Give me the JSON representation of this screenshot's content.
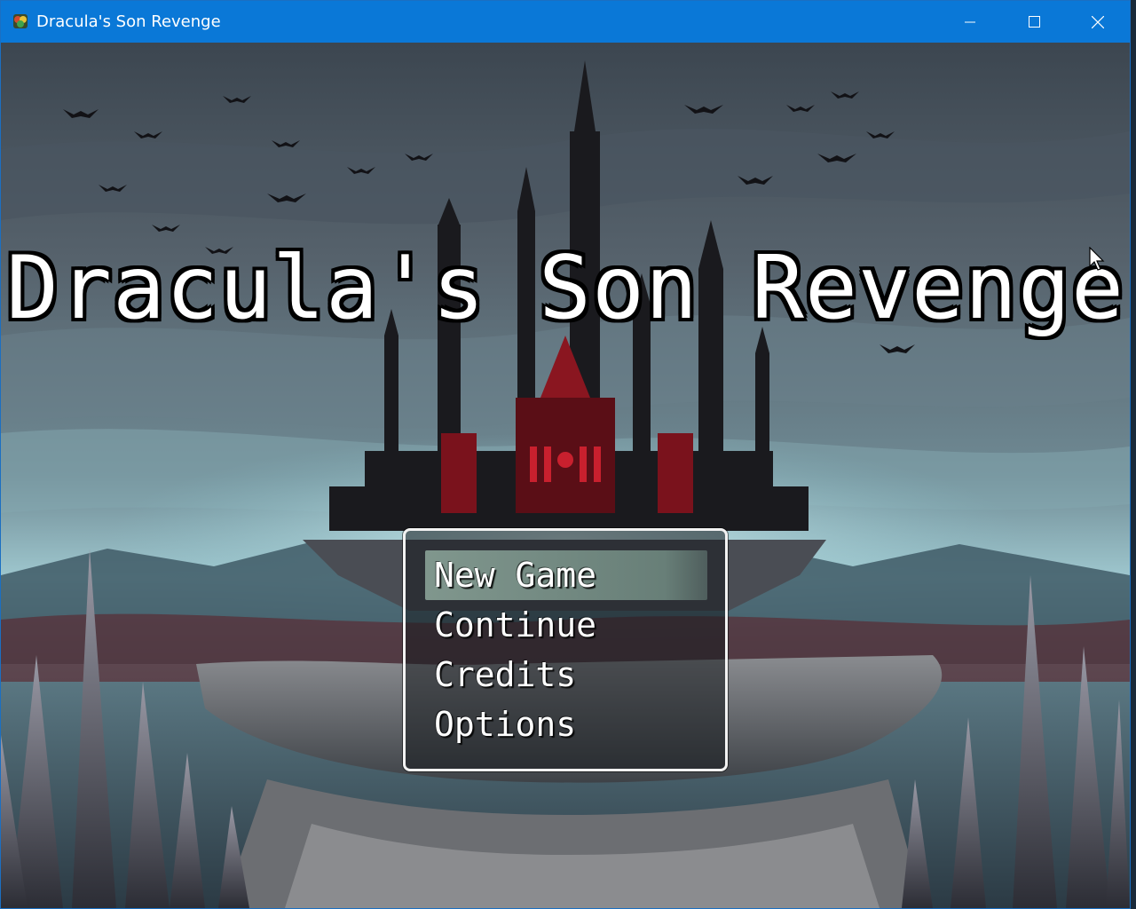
{
  "window": {
    "title": "Dracula's Son Revenge",
    "accent_color": "#0a78d7",
    "controls": [
      "minimize-icon",
      "maximize-icon",
      "close-icon"
    ]
  },
  "game": {
    "title": "Dracula's Son Revenge",
    "menu": {
      "selected_index": 0,
      "items": [
        {
          "label": "New Game"
        },
        {
          "label": "Continue"
        },
        {
          "label": "Credits"
        },
        {
          "label": "Options"
        }
      ]
    }
  }
}
